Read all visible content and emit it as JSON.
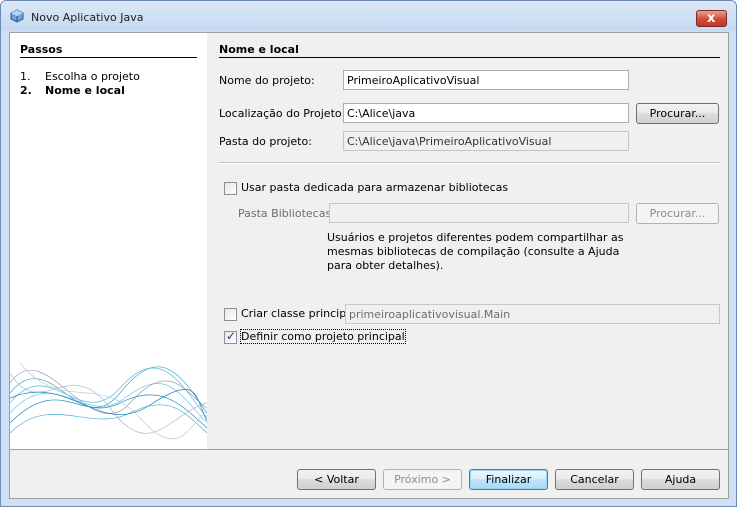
{
  "window": {
    "title": "Novo Aplicativo Java",
    "close_glyph": "x"
  },
  "steps": {
    "title": "Passos",
    "items": [
      {
        "num": "1.",
        "label": "Escolha o projeto"
      },
      {
        "num": "2.",
        "label": "Nome e local"
      }
    ]
  },
  "section_title": "Nome e local",
  "project_name": {
    "label": "Nome do projeto:",
    "value": "PrimeiroAplicativoVisual"
  },
  "project_location": {
    "label": "Localização do Projeto:",
    "value": "C:\\Alice\\java",
    "browse": "Procurar..."
  },
  "project_folder": {
    "label": "Pasta do projeto:",
    "value": "C:\\Alice\\java\\PrimeiroAplicativoVisual"
  },
  "dedicated_folder": {
    "label": "Usar pasta dedicada para armazenar bibliotecas",
    "checked": false
  },
  "libraries_folder": {
    "label": "Pasta Bibliotecas:",
    "value": "",
    "browse": "Procurar..."
  },
  "libraries_note": "Usuários e projetos diferentes podem compartilhar as mesmas bibliotecas de compilação (consulte a Ajuda para obter detalhes).",
  "main_class": {
    "label": "Criar classe principal",
    "checked": false,
    "value": "primeiroaplicativovisual.Main"
  },
  "main_project": {
    "label": "Definir como projeto principal",
    "checked": true,
    "check_glyph": "✓"
  },
  "buttons": {
    "back": "< Voltar",
    "next": "Próximo >",
    "finish": "Finalizar",
    "cancel": "Cancelar",
    "help": "Ajuda"
  },
  "colors": {
    "titlebar": "#c5d9f0",
    "close": "#c0392b",
    "panel": "#f0f0f0",
    "steps_bg": "#ffffff"
  }
}
